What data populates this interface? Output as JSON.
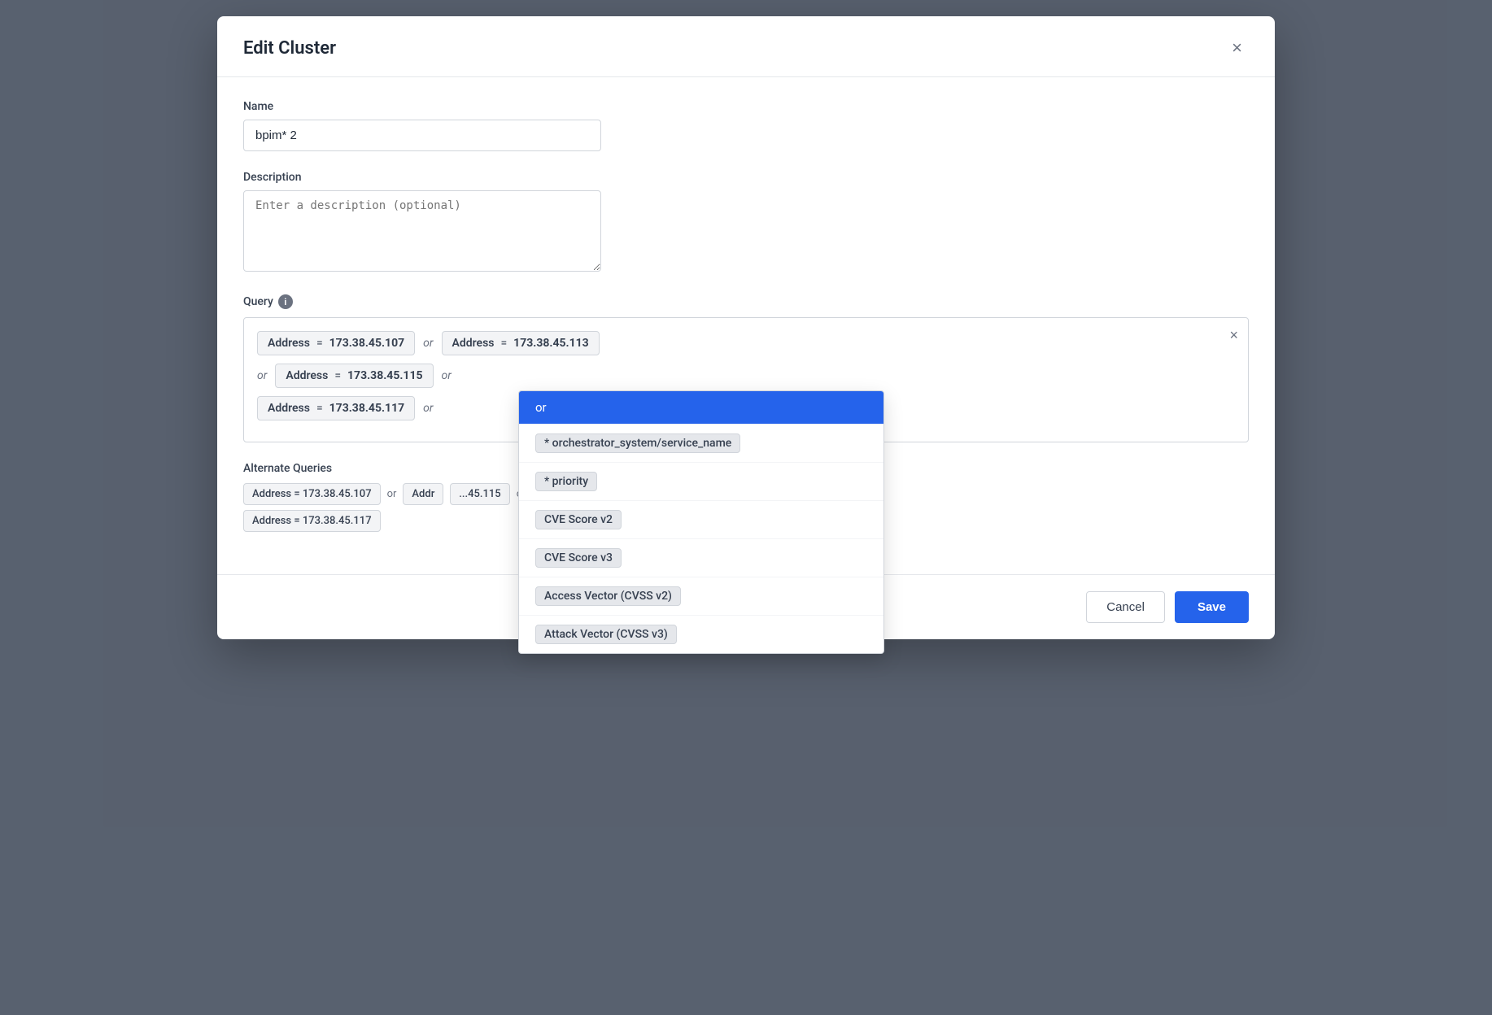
{
  "modal": {
    "title": "Edit Cluster",
    "close_label": "×"
  },
  "form": {
    "name_label": "Name",
    "name_value": "bpim* 2",
    "description_label": "Description",
    "description_placeholder": "Enter a description (optional)",
    "query_label": "Query",
    "info_icon": "i",
    "alternate_queries_label": "Alternate Queries"
  },
  "query": {
    "rows": [
      {
        "chips": [
          {
            "field": "Address",
            "operator": "=",
            "value": "173.38.45.107"
          },
          {
            "or": true
          },
          {
            "field": "Address",
            "operator": "=",
            "value": "173.38.45.113"
          }
        ]
      },
      {
        "chips": [
          {
            "or_prefix": "or"
          },
          {
            "field": "Address",
            "operator": "=",
            "value": "173.38.45.115"
          },
          {
            "or": true
          }
        ]
      },
      {
        "chips": [
          {
            "field": "Address",
            "operator": "=",
            "value": "173.38.45.117"
          },
          {
            "or_suffix": "or"
          }
        ]
      }
    ]
  },
  "alternate_queries": [
    {
      "items": [
        {
          "type": "chip",
          "text": "Address = 173.38.45.107"
        },
        {
          "type": "or",
          "text": "or"
        },
        {
          "type": "chip",
          "text": "Addr"
        },
        {
          "type": "ellipsis",
          "text": "...45.115"
        },
        {
          "type": "or",
          "text": "or"
        }
      ]
    },
    {
      "items": [
        {
          "type": "chip",
          "text": "Address = 173.38.45.117"
        }
      ]
    }
  ],
  "dropdown": {
    "items": [
      {
        "label": "or",
        "active": true
      },
      {
        "label": "* orchestrator_system/service_name",
        "tag": true
      },
      {
        "label": "* priority",
        "tag": true
      },
      {
        "label": "CVE Score v2",
        "tag": true
      },
      {
        "label": "CVE Score v3",
        "tag": true
      },
      {
        "label": "Access Vector (CVSS v2)",
        "tag": true
      },
      {
        "label": "Attack Vector (CVSS v3)",
        "tag": true
      }
    ]
  },
  "footer": {
    "cancel_label": "Cancel",
    "save_label": "Save"
  }
}
